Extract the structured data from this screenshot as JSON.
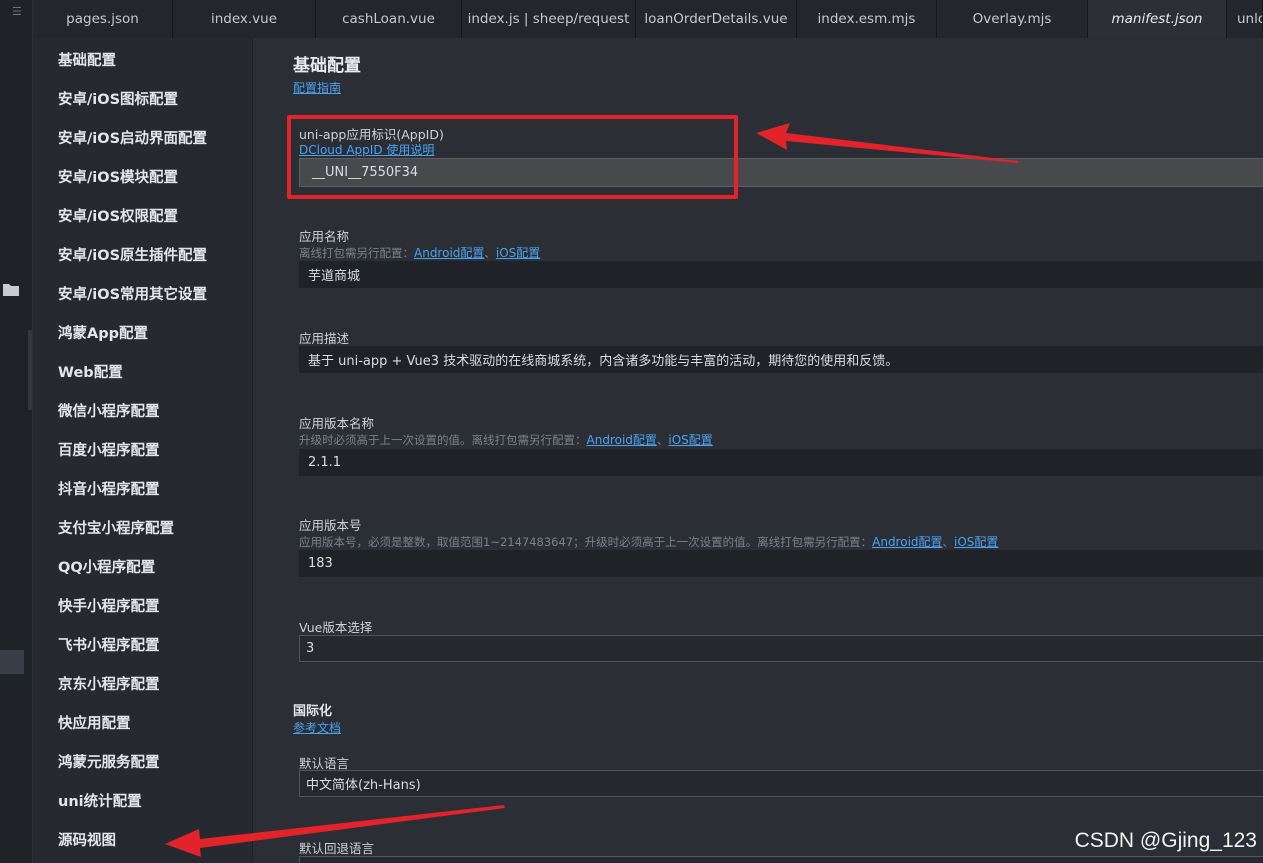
{
  "tabs": [
    {
      "label": "pages.json",
      "active": false
    },
    {
      "label": "index.vue",
      "active": false
    },
    {
      "label": "cashLoan.vue",
      "active": false
    },
    {
      "label": "index.js | sheep/request",
      "active": false
    },
    {
      "label": "loanOrderDetails.vue",
      "active": false
    },
    {
      "label": "index.esm.mjs",
      "active": false
    },
    {
      "label": "Overlay.mjs",
      "active": false
    },
    {
      "label": "manifest.json",
      "active": true
    },
    {
      "label": "unlo",
      "active": false
    }
  ],
  "sidebar": {
    "items": [
      "基础配置",
      "安卓/iOS图标配置",
      "安卓/iOS启动界面配置",
      "安卓/iOS模块配置",
      "安卓/iOS权限配置",
      "安卓/iOS原生插件配置",
      "安卓/iOS常用其它设置",
      "鸿蒙App配置",
      "Web配置",
      "微信小程序配置",
      "百度小程序配置",
      "抖音小程序配置",
      "支付宝小程序配置",
      "QQ小程序配置",
      "快手小程序配置",
      "飞书小程序配置",
      "京东小程序配置",
      "快应用配置",
      "鸿蒙元服务配置",
      "uni统计配置",
      "源码视图"
    ]
  },
  "main": {
    "title": "基础配置",
    "guide_link": "配置指南",
    "appid": {
      "label": "uni-app应用标识(AppID)",
      "link": "DCloud AppID 使用说明",
      "value": "__UNI__7550F34"
    },
    "app_name": {
      "label": "应用名称",
      "hint": "离线打包需另行配置：",
      "link_android": "Android配置",
      "sep": "、",
      "link_ios": "iOS配置",
      "value": "芋道商城"
    },
    "app_desc": {
      "label": "应用描述",
      "value": "基于 uni-app + Vue3 技术驱动的在线商城系统，内含诸多功能与丰富的活动，期待您的使用和反馈。"
    },
    "version_name": {
      "label": "应用版本名称",
      "hint": "升级时必须高于上一次设置的值。离线打包需另行配置：",
      "link_android": "Android配置",
      "sep": "、",
      "link_ios": "iOS配置",
      "value": "2.1.1"
    },
    "version_code": {
      "label": "应用版本号",
      "hint": "应用版本号，必须是整数，取值范围1~2147483647；升级时必须高于上一次设置的值。离线打包需另行配置：",
      "link_android": "Android配置",
      "sep": "、",
      "link_ios": "iOS配置",
      "value": "183"
    },
    "vue_version": {
      "label": "Vue版本选择",
      "value": "3"
    },
    "i18n": {
      "title": "国际化",
      "link": "参考文档",
      "default_lang_label": "默认语言",
      "default_lang_value": "中文简体(zh-Hans)",
      "fallback_lang_label": "默认回退语言"
    }
  },
  "annotation_color": "#e3232a",
  "watermark": "CSDN @Gjing_123"
}
